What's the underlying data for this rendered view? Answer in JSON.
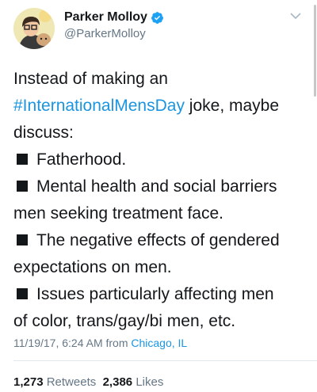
{
  "author": {
    "display_name": "Parker Molloy",
    "handle": "@ParkerMolloy",
    "avatar_icon": "cartoon-avatar-icon",
    "verified_icon": "verified-badge-icon",
    "menu_icon": "chevron-down-icon"
  },
  "tweet": {
    "lines": [
      {
        "text": "Instead of making an"
      },
      {
        "hashtag": "#InternationalMensDay",
        "text": " joke, maybe"
      },
      {
        "text": "discuss:"
      },
      {
        "bullet": true,
        "text": "Fatherhood."
      },
      {
        "bullet": true,
        "text": "Mental health and social barriers"
      },
      {
        "text": "men seeking treatment face."
      },
      {
        "bullet": true,
        "text": "The negative effects of gendered"
      },
      {
        "text": "expectations on men."
      },
      {
        "bullet": true,
        "text": "Issues particularly affecting men"
      },
      {
        "text": "of color, trans/gay/bi men, etc."
      }
    ]
  },
  "meta": {
    "timestamp": "11/19/17, 6:24 AM",
    "from_word": "from",
    "location": "Chicago, IL"
  },
  "stats": {
    "retweets_count": "1,273",
    "retweets_label": "Retweets",
    "likes_count": "2,386",
    "likes_label": "Likes"
  },
  "colors": {
    "link": "#1b95e0",
    "text": "#14171a",
    "secondary": "#657786"
  }
}
